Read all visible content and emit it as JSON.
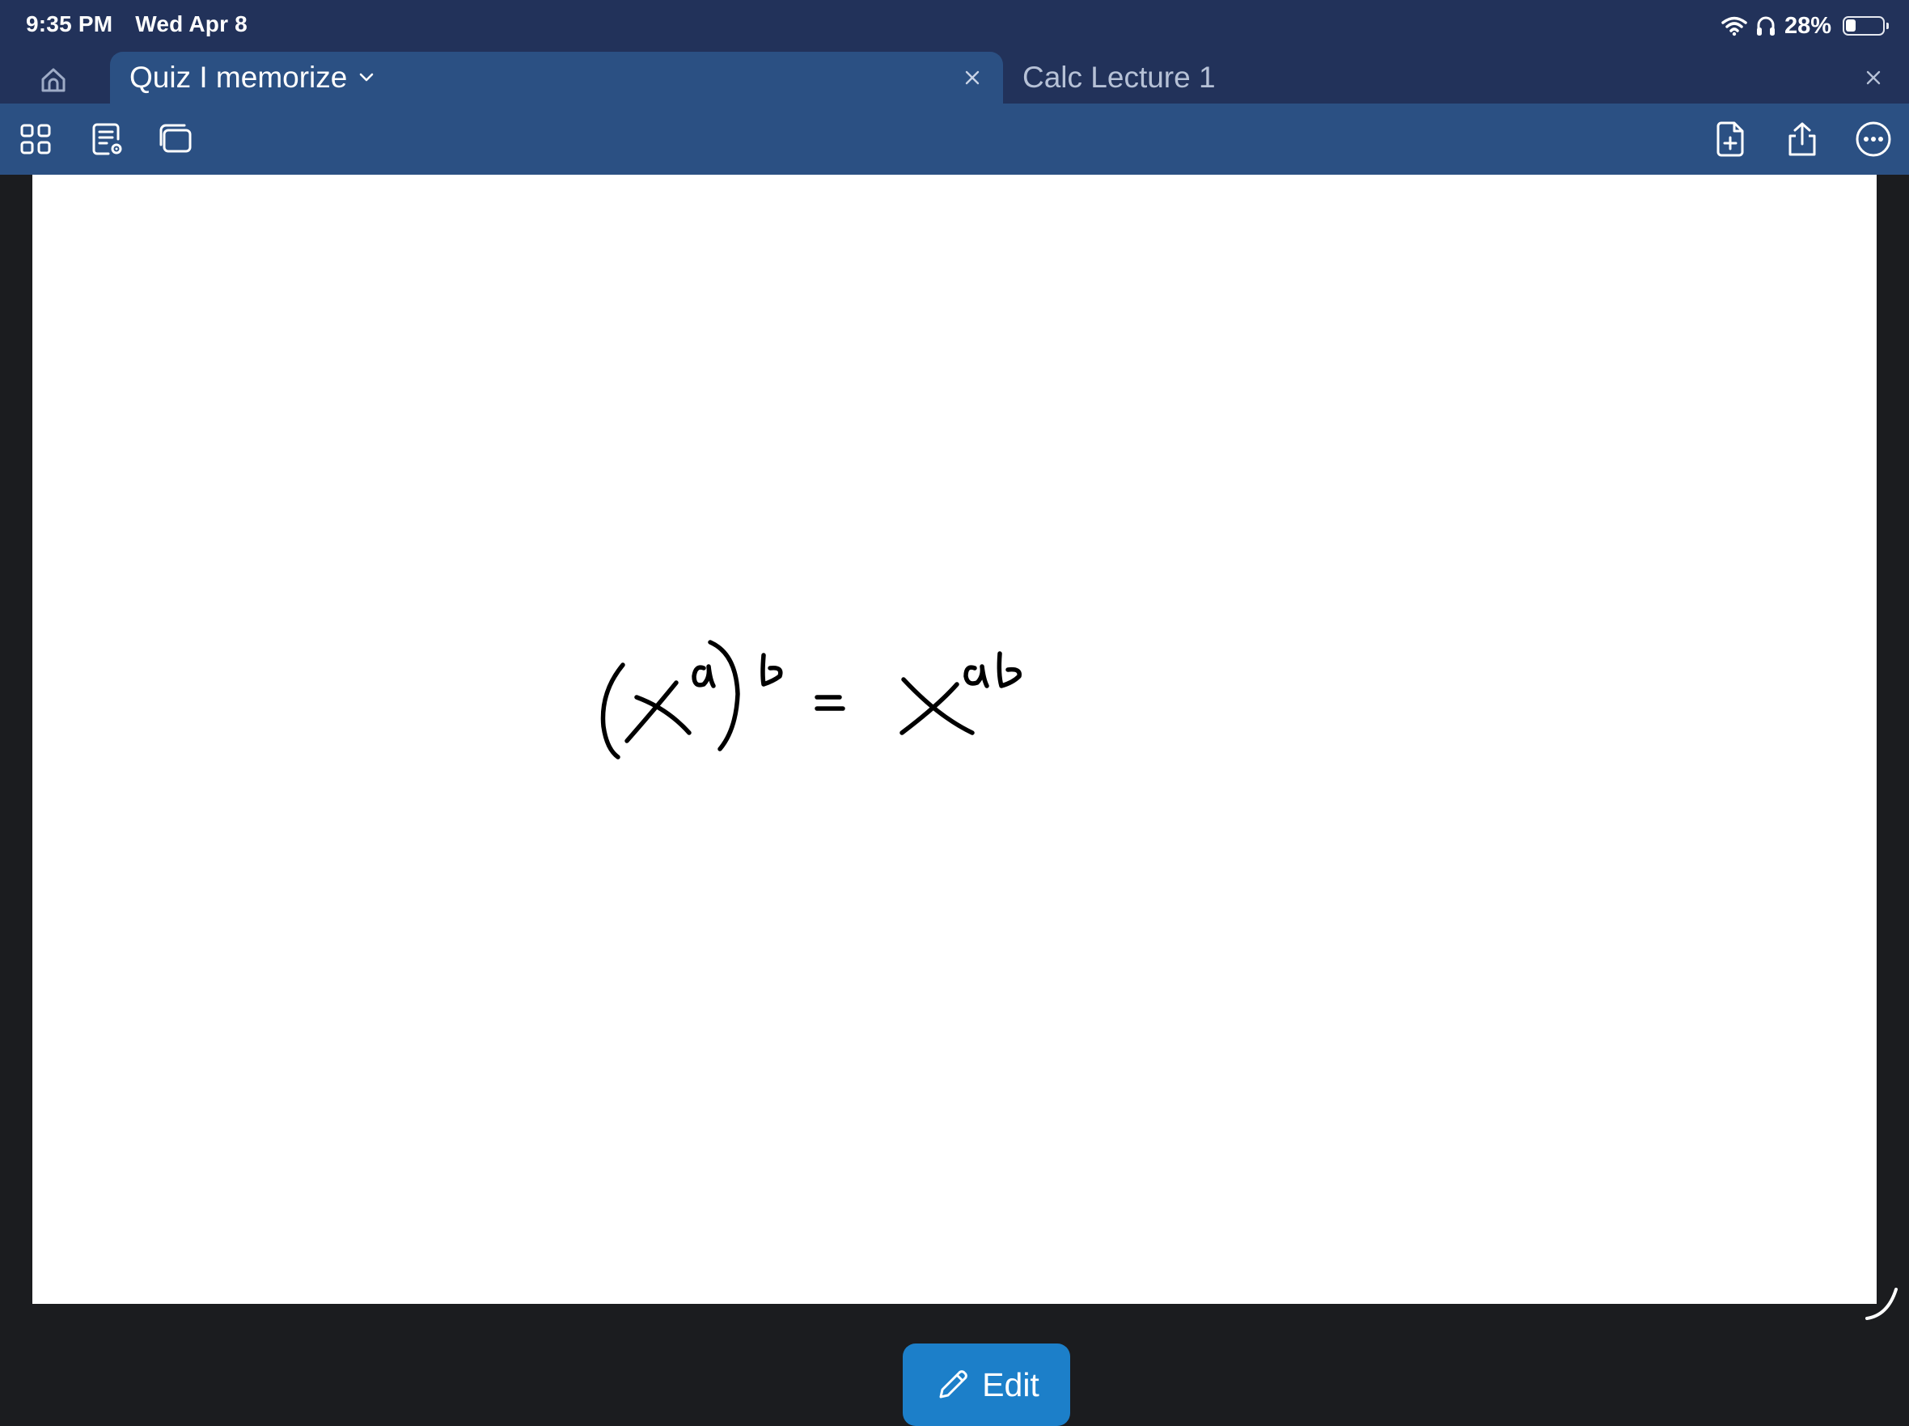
{
  "status_bar": {
    "time": "9:35 PM",
    "date": "Wed Apr 8",
    "battery_text": "28%",
    "battery_level": 0.28,
    "icons": [
      "wifi-icon",
      "headphones-icon",
      "battery-icon"
    ]
  },
  "tabs": [
    {
      "title": "Quiz I memorize",
      "active": true,
      "has_dropdown": true
    },
    {
      "title": "Calc Lecture 1",
      "active": false,
      "has_dropdown": false
    }
  ],
  "toolbar": {
    "left_icons": [
      "thumbnails-grid-icon",
      "reading-mode-icon",
      "pages-stack-icon"
    ],
    "right_icons": [
      "add-page-icon",
      "share-icon",
      "more-options-icon"
    ]
  },
  "note": {
    "content": "(x^a)^b = x^ab",
    "ink_color": "#000000"
  },
  "edit_button": {
    "label": "Edit",
    "icon": "pencil-icon"
  },
  "colors": {
    "status_bar": "#22325a",
    "toolbar": "#2b5083",
    "edit_button": "#1c7fc9",
    "page": "#ffffff"
  }
}
